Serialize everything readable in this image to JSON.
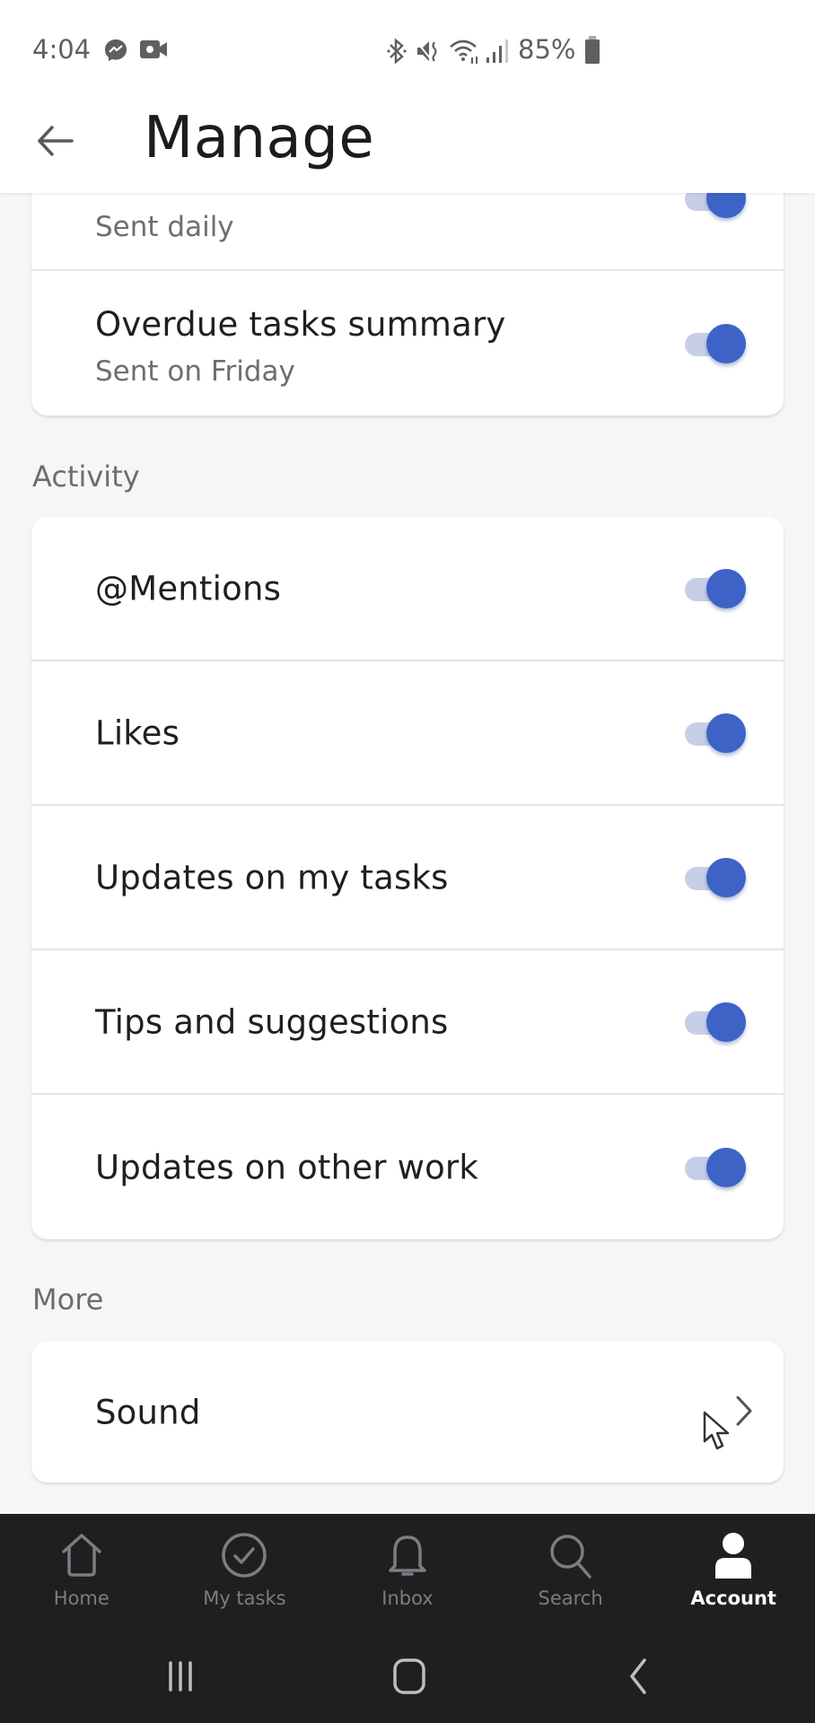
{
  "status_bar": {
    "time": "4:04",
    "left_icons": [
      "messenger-icon",
      "video-call-icon"
    ],
    "right_icons": [
      "bluetooth-icon",
      "mute-icon",
      "wifi-icon",
      "signal-icon"
    ],
    "battery_percent": "85%"
  },
  "header": {
    "back_icon": "arrow-left-icon",
    "title": "Manage"
  },
  "sections": [
    {
      "label": "",
      "rows": [
        {
          "title": "",
          "subtitle": "Sent daily",
          "toggle_on": true
        },
        {
          "title": "Overdue tasks summary",
          "subtitle": "Sent on Friday",
          "toggle_on": true
        }
      ]
    },
    {
      "label": "Activity",
      "rows": [
        {
          "title": "@Mentions",
          "toggle_on": true
        },
        {
          "title": "Likes",
          "toggle_on": true
        },
        {
          "title": "Updates on my tasks",
          "toggle_on": true
        },
        {
          "title": "Tips and suggestions",
          "toggle_on": true
        },
        {
          "title": "Updates on other work",
          "toggle_on": true
        }
      ]
    },
    {
      "label": "More",
      "rows": [
        {
          "title": "Sound",
          "trailing_icon": "chevron-right-icon"
        }
      ]
    }
  ],
  "bottom_nav": {
    "items": [
      {
        "label": "Home",
        "icon": "home-icon",
        "active": false
      },
      {
        "label": "My tasks",
        "icon": "check-circle-icon",
        "active": false
      },
      {
        "label": "Inbox",
        "icon": "bell-icon",
        "active": false
      },
      {
        "label": "Search",
        "icon": "search-icon",
        "active": false
      },
      {
        "label": "Account",
        "icon": "person-icon",
        "active": true
      }
    ]
  },
  "system_nav": [
    "recents-icon",
    "home-button-icon",
    "back-icon"
  ],
  "colors": {
    "accent": "#3d63c6",
    "toggle_track": "#c7cfe8",
    "background": "#f6f6f6",
    "nav_background": "#1e1f21",
    "nav_inactive": "#7c7d80",
    "nav_active": "#ffffff"
  }
}
